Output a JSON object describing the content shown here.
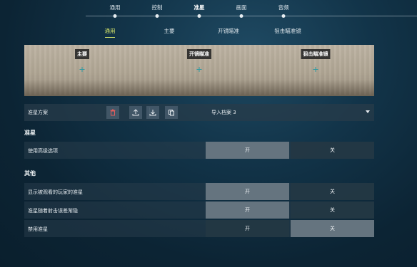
{
  "top_tabs": [
    {
      "label": "通用",
      "active": false
    },
    {
      "label": "控制",
      "active": false
    },
    {
      "label": "准星",
      "active": true
    },
    {
      "label": "画面",
      "active": false
    },
    {
      "label": "音频",
      "active": false
    }
  ],
  "sub_tabs": [
    {
      "label": "通用",
      "active": true
    },
    {
      "label": "主要",
      "active": false
    },
    {
      "label": "开镜瞄准",
      "active": false
    },
    {
      "label": "狙击瞄准镜",
      "active": false
    }
  ],
  "preview": {
    "tags": [
      "主要",
      "开镜瞄准",
      "狙击瞄准镜"
    ],
    "crosshair_color": "#2f9aa2"
  },
  "profile": {
    "label": "准星方案",
    "buttons": [
      "delete-icon",
      "upload-icon",
      "download-icon",
      "copy-icon"
    ],
    "selected": "导入档案 3"
  },
  "sections": [
    {
      "title": "准星",
      "rows": [
        {
          "label": "使用高级选项",
          "on": "开",
          "off": "关",
          "value": "on"
        }
      ]
    },
    {
      "title": "其他",
      "rows": [
        {
          "label": "显示被观看的玩家的准星",
          "on": "开",
          "off": "关",
          "value": "on"
        },
        {
          "label": "准星随着射击误差渐隐",
          "on": "开",
          "off": "关",
          "value": "on"
        },
        {
          "label": "禁用准星",
          "on": "开",
          "off": "关",
          "value": "off"
        }
      ]
    }
  ]
}
